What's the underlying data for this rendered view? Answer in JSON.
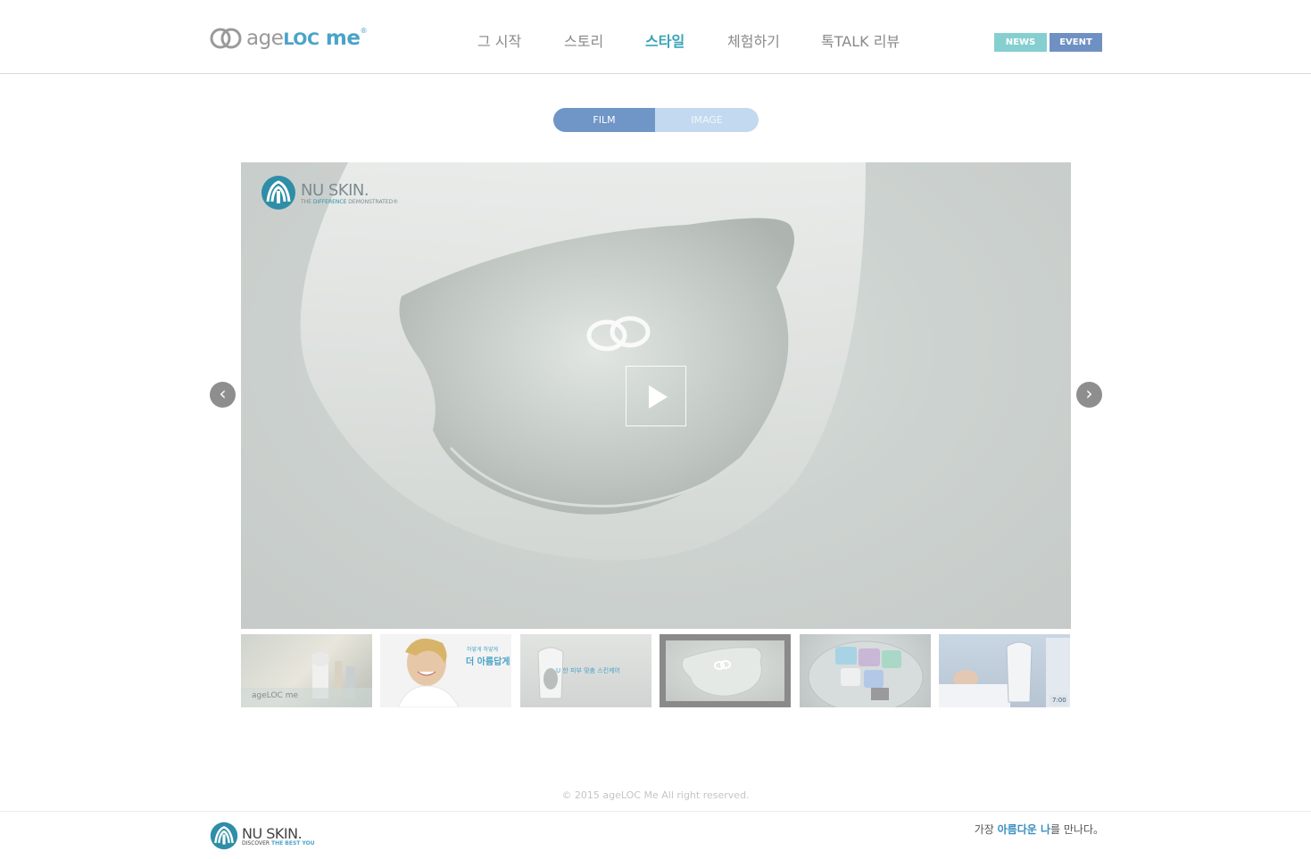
{
  "header": {
    "logo": {
      "prefix": "age",
      "loc": "LOC",
      "me": " me",
      "reg": "®"
    },
    "nav": [
      {
        "label": "그 시작",
        "active": false
      },
      {
        "label": "스토리",
        "active": false
      },
      {
        "label": "스타일",
        "active": true
      },
      {
        "label": "체험하기",
        "active": false
      },
      {
        "label": "톡TALK 리뷰",
        "active": false
      }
    ],
    "news_label": "NEWS",
    "event_label": "EVENT"
  },
  "tabs": {
    "film": "FILM",
    "image": "IMAGE",
    "selected": "FILM"
  },
  "video": {
    "watermark_title": "NU SKIN.",
    "watermark_sub_prefix": "THE ",
    "watermark_sub_highlight": "DIFFERENCE",
    "watermark_sub_suffix": " DEMONSTRATED®",
    "play_icon": "play-icon"
  },
  "carousel": {
    "prev_icon": "chevron-left-icon",
    "next_icon": "chevron-right-icon",
    "thumbnails": [
      {
        "caption": "ageLOC me"
      },
      {
        "caption": "더 아름답게",
        "caption_small": "하얗게 하얗게"
      },
      {
        "caption": "U 한 피부 맞춤 스킨케어"
      },
      {
        "caption": "",
        "selected": true
      },
      {
        "caption": ""
      },
      {
        "caption": "7:00"
      }
    ]
  },
  "footer": {
    "copyright": "© 2015 ageLOC Me All right reserved.",
    "logo_title": "NU SKIN.",
    "logo_sub_prefix": "DISCOVER ",
    "logo_sub_highlight": "THE BEST YOU",
    "tagline_prefix": "가장 ",
    "tagline_highlight": "아름다운 나",
    "tagline_suffix": "를 만나다。"
  },
  "colors": {
    "accent_teal": "#3aa4b7",
    "news_bg": "#86cfd0",
    "event_bg": "#6f90c2",
    "tab_active": "#6f96c6",
    "tab_inactive": "#c3d9ef"
  }
}
